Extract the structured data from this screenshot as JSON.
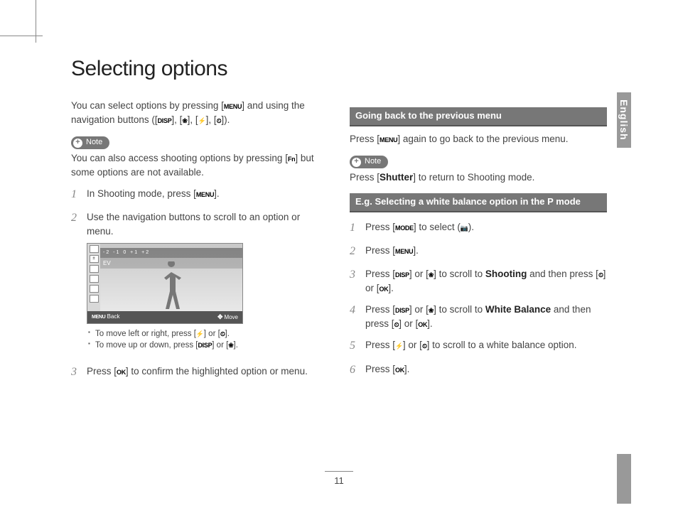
{
  "language_tab": "English",
  "title": "Selecting options",
  "page_number": "11",
  "icons": {
    "menu": "MENU",
    "disp": "DISP",
    "macro": "❀",
    "flash": "⚡",
    "timer": "⏲",
    "fn": "Fn",
    "ok": "OK",
    "mode": "MODE",
    "camera": "📷",
    "shutter": "Shutter",
    "nav": "✥"
  },
  "left": {
    "intro_a": "You can select options by pressing [",
    "intro_b": "] and using the navigation buttons ([",
    "intro_c": "], [",
    "intro_d": "], [",
    "intro_e": "], [",
    "intro_f": "]).",
    "note_label": "Note",
    "note_a": "You can also access shooting options by pressing [",
    "note_b": "] but some options are not available.",
    "step1_a": "In Shooting mode, press [",
    "step1_b": "].",
    "step2": "Use the navigation buttons to scroll to an option or menu.",
    "screenshot": {
      "ev_scale": "-2   -1    0    +1   +2",
      "ev_label": "EV",
      "foot_back": "Back",
      "foot_move": "Move"
    },
    "bullet1_a": "To move left or right, press [",
    "bullet1_b": "] or [",
    "bullet1_c": "].",
    "bullet2_a": "To move up or down, press [",
    "bullet2_b": "] or [",
    "bullet2_c": "].",
    "step3_a": "Press [",
    "step3_b": "] to confirm the highlighted option or menu."
  },
  "right": {
    "section1_title": "Going back to the previous menu",
    "s1_a": "Press [",
    "s1_b": "] again to go back to the previous menu.",
    "note_label": "Note",
    "note_a": "Press [",
    "note_b": "] to return to Shooting mode.",
    "section2_title": "E.g. Selecting a white balance option in the P mode",
    "r1_a": "Press [",
    "r1_b": "] to select (",
    "r1_c": ").",
    "r2_a": "Press [",
    "r2_b": "].",
    "r3_a": "Press [",
    "r3_b": "] or [",
    "r3_c": "] to scroll to ",
    "r3_bold": "Shooting",
    "r3_d": " and then press [",
    "r3_e": "] or [",
    "r3_f": "].",
    "r4_a": "Press [",
    "r4_b": "] or [",
    "r4_c": "] to scroll to ",
    "r4_bold": "White Balance",
    "r4_d": " and then press [",
    "r4_e": "] or [",
    "r4_f": "].",
    "r5_a": "Press [",
    "r5_b": "] or [",
    "r5_c": "] to scroll to a white balance option.",
    "r6_a": "Press [",
    "r6_b": "]."
  }
}
